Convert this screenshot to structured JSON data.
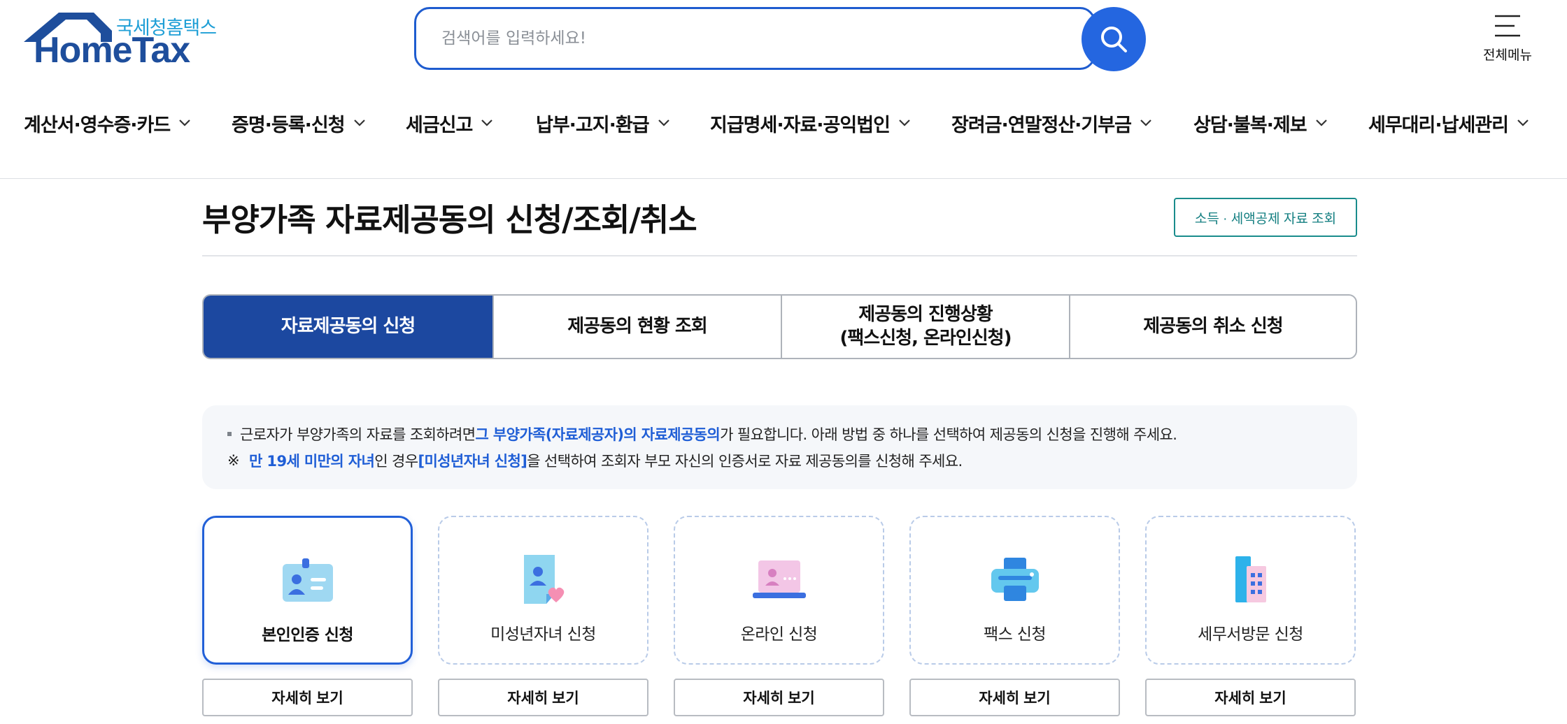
{
  "header": {
    "logo": {
      "sub": "국세청홈택스",
      "main": "HomeTax"
    },
    "search": {
      "placeholder": "검색어를 입력하세요!",
      "value": ""
    },
    "all_menu_label": "전체메뉴",
    "nav": [
      {
        "label": "계산서·영수증·카드"
      },
      {
        "label": "증명·등록·신청"
      },
      {
        "label": "세금신고"
      },
      {
        "label": "납부·고지·환급"
      },
      {
        "label": "지급명세·자료·공익법인"
      },
      {
        "label": "장려금·연말정산·기부금"
      },
      {
        "label": "상담·불복·제보"
      },
      {
        "label": "세무대리·납세관리"
      }
    ]
  },
  "page": {
    "title": "부양가족 자료제공동의 신청/조회/취소",
    "lookup_button": "소득 · 세액공제 자료 조회"
  },
  "tabs": [
    {
      "line1": "자료제공동의 신청",
      "line2": "",
      "active": true
    },
    {
      "line1": "제공동의 현황 조회",
      "line2": "",
      "active": false
    },
    {
      "line1": "제공동의 진행상황",
      "line2": "(팩스신청, 온라인신청)",
      "active": false
    },
    {
      "line1": "제공동의 취소 신청",
      "line2": "",
      "active": false
    }
  ],
  "notice": {
    "line1": {
      "before": "근로자가 부양가족의 자료를 조회하려면 ",
      "highlight": "그 부양가족(자료제공자)의 자료제공동의",
      "after": "가 필요합니다. 아래 방법 중 하나를 선택하여 제공동의 신청을 진행해 주세요."
    },
    "line2": {
      "mark": "※",
      "highlight1": "만 19세 미만의 자녀",
      "middle": "인 경우 ",
      "highlight2": "[미성년자녀 신청]",
      "after": "을 선택하여 조회자 부모 자신의 인증서로 자료 제공동의를 신청해 주세요."
    }
  },
  "methods": [
    {
      "label": "본인인증 신청",
      "icon": "id-card-icon",
      "selected": true,
      "detail_label": "자세히 보기"
    },
    {
      "label": "미성년자녀 신청",
      "icon": "child-document-heart-icon",
      "selected": false,
      "detail_label": "자세히 보기"
    },
    {
      "label": "온라인 신청",
      "icon": "laptop-icon",
      "selected": false,
      "detail_label": "자세히 보기"
    },
    {
      "label": "팩스 신청",
      "icon": "fax-printer-icon",
      "selected": false,
      "detail_label": "자세히 보기"
    },
    {
      "label": "세무서방문 신청",
      "icon": "tax-office-building-icon",
      "selected": false,
      "detail_label": "자세히 보기"
    }
  ],
  "colors": {
    "primary": "#1c48a0",
    "accent_blue": "#2466e0",
    "highlight_text": "#1f5ed6",
    "teal_button": "#127e80"
  }
}
